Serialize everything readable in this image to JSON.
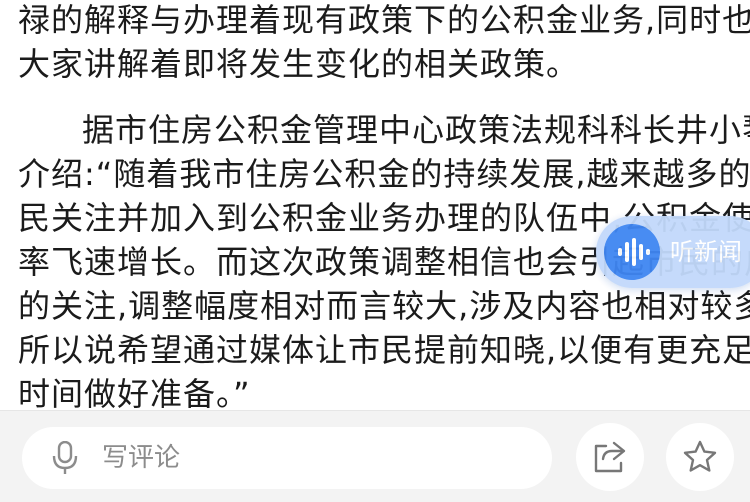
{
  "article": {
    "lines": [
      "禄的解释与办理着现有政策下的公积金业务,同时也向",
      "大家讲解着即将发生变化的相关政策。",
      "据市住房公积金管理中心政策法规科科长井小琴",
      "介绍:“随着我市住房公积金的持续发展,越来越多的市",
      "民关注并加入到公积金业务办理的队伍中,公积金使用",
      "率飞速增长。而这次政策调整相信也会引起市民的广泛",
      "的关注,调整幅度相对而言较大,涉及内容也相对较多,",
      "所以说希望通过媒体让市民提前知晓,以便有更充足的",
      "时间做好准备。”"
    ]
  },
  "listen_widget": {
    "label": "听新闻",
    "icon": "sound-wave-icon",
    "bg_color": "#c2d9fb",
    "icon_color": "#3f86f2"
  },
  "bottom_bar": {
    "comment_placeholder": "写评论",
    "mic_icon": "microphone-icon",
    "share_icon": "share-icon",
    "favorite_icon": "star-icon"
  }
}
